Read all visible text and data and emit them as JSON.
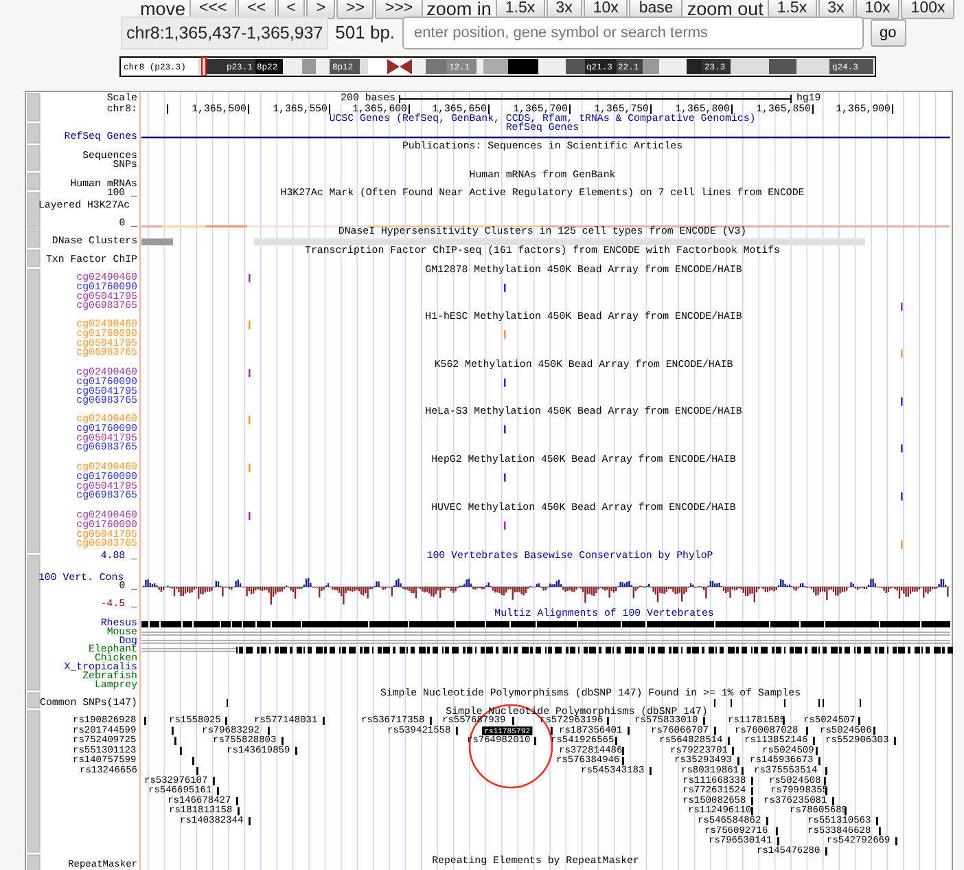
{
  "navigation": {
    "move_label": "move",
    "move_buttons": [
      "<<<",
      "<<",
      "<",
      ">",
      ">>",
      ">>>"
    ],
    "zoom_in_label": "zoom in",
    "zoom_in_buttons": [
      "1.5x",
      "3x",
      "10x",
      "base"
    ],
    "zoom_out_label": "zoom out",
    "zoom_out_buttons": [
      "1.5x",
      "3x",
      "10x",
      "100x"
    ]
  },
  "position": {
    "value": "chr8:1,365,437-1,365,937",
    "size": "501 bp.",
    "search_placeholder": "enter position, gene symbol or search terms",
    "go_button": "go"
  },
  "ideogram": {
    "chromosome_label": "chr8 (p23.3)",
    "bands": [
      "p23.1",
      "8p22",
      "8p12",
      "12.1",
      "q21.3",
      "22.1",
      "23.3",
      "q24.3"
    ]
  },
  "ruler": {
    "scale_label": "Scale",
    "scale_text": "200 bases",
    "assembly": "hg19",
    "chrom_label": "chr8:",
    "positions": [
      "1,365,500",
      "1,365,550",
      "1,365,600",
      "1,365,650",
      "1,365,700",
      "1,365,750",
      "1,365,800",
      "1,365,850",
      "1,365,900"
    ]
  },
  "gene_tracks": {
    "ucsc_genes_title": "UCSC Genes (RefSeq, GenBank, CCDS, Rfam, tRNAs & Comparative Genomics)",
    "refseq_title": "RefSeq Genes",
    "refseq_label": "RefSeq Genes",
    "publications_title": "Publications: Sequences in Scientific Articles",
    "publications_labels": [
      "Sequences",
      "SNPs"
    ],
    "mrna_title": "Human mRNAs from GenBank",
    "mrna_label": "Human mRNAs"
  },
  "h3k27ac": {
    "title": "H3K27Ac Mark (Often Found Near Active Regulatory Elements) on 7 cell lines from ENCODE",
    "label": "Layered H3K27Ac",
    "max": "100 _",
    "min": "0 _"
  },
  "dnase": {
    "title": "DNaseI Hypersensitivity Clusters in 125 cell types from ENCODE (V3)",
    "label": "DNase Clusters"
  },
  "txn_factor": {
    "title": "Transcription Factor ChIP-seq (161 factors) from ENCODE with Factorbook Motifs",
    "label": "Txn Factor ChIP"
  },
  "methylation": [
    {
      "title": "GM12878 Methylation 450K Bead Array from ENCODE/HAIB",
      "probes": [
        {
          "label": "cg02490460",
          "color": "#a03ca0"
        },
        {
          "label": "cg01760090",
          "color": "#3333dd"
        },
        {
          "label": "cg05041795",
          "color": "#a03ca0"
        },
        {
          "label": "cg06983765",
          "color": "#a03ca0"
        }
      ]
    },
    {
      "title": "H1-hESC Methylation 450K Bead Array from ENCODE/HAIB",
      "probes": [
        {
          "label": "cg02490460",
          "color": "#ff9933"
        },
        {
          "label": "cg01760090",
          "color": "#ff9933"
        },
        {
          "label": "cg05041795",
          "color": "#ff9933"
        },
        {
          "label": "cg06983765",
          "color": "#ff9933"
        }
      ]
    },
    {
      "title": "K562 Methylation 450K Bead Array from ENCODE/HAIB",
      "probes": [
        {
          "label": "cg02490460",
          "color": "#a03ca0"
        },
        {
          "label": "cg01760090",
          "color": "#3333dd"
        },
        {
          "label": "cg05041795",
          "color": "#3333dd"
        },
        {
          "label": "cg06983765",
          "color": "#3333dd"
        }
      ]
    },
    {
      "title": "HeLa-S3 Methylation 450K Bead Array from ENCODE/HAIB",
      "probes": [
        {
          "label": "cg02490460",
          "color": "#ff9933"
        },
        {
          "label": "cg01760090",
          "color": "#3333dd"
        },
        {
          "label": "cg05041795",
          "color": "#a03ca0"
        },
        {
          "label": "cg06983765",
          "color": "#3333dd"
        }
      ]
    },
    {
      "title": "HepG2 Methylation 450K Bead Array from ENCODE/HAIB",
      "probes": [
        {
          "label": "cg02490460",
          "color": "#ff9933"
        },
        {
          "label": "cg01760090",
          "color": "#3333dd"
        },
        {
          "label": "cg05041795",
          "color": "#a03ca0"
        },
        {
          "label": "cg06983765",
          "color": "#3333dd"
        }
      ]
    },
    {
      "title": "HUVEC Methylation 450K Bead Array from ENCODE/HAIB",
      "probes": [
        {
          "label": "cg02490460",
          "color": "#a03ca0"
        },
        {
          "label": "cg01760090",
          "color": "#a03ca0"
        },
        {
          "label": "cg05041795",
          "color": "#ff9933"
        },
        {
          "label": "cg06983765",
          "color": "#ff9933"
        }
      ]
    }
  ],
  "conservation": {
    "title": "100 Vertebrates Basewise Conservation by PhyloP",
    "label": "100 Vert. Cons",
    "max": "4.88 _",
    "zero": "0 _",
    "min": "-4.5 _",
    "multiz_title": "Multiz Alignments of 100 Vertebrates",
    "species": [
      {
        "name": "Rhesus",
        "color": "#000099"
      },
      {
        "name": "Mouse",
        "color": "#006600"
      },
      {
        "name": "Dog",
        "color": "#000099"
      },
      {
        "name": "Elephant",
        "color": "#006600"
      },
      {
        "name": "Chicken",
        "color": "#006600"
      },
      {
        "name": "X_tropicalis",
        "color": "#000099"
      },
      {
        "name": "Zebrafish",
        "color": "#006600"
      },
      {
        "name": "Lamprey",
        "color": "#006600"
      }
    ]
  },
  "common_snps": {
    "title": "Simple Nucleotide Polymorphisms (dbSNP 147) Found in >= 1% of Samples",
    "label": "Common SNPs(147)"
  },
  "snps": {
    "title": "Simple Nucleotide Polymorphisms (dbSNP 147)",
    "rows": [
      {
        "snps": [
          {
            "label": "rs190826928",
            "selected": false
          },
          {
            "label": "rs1558025",
            "selected": false
          },
          {
            "label": "rs577148031",
            "selected": false
          },
          {
            "label": "rs536717358",
            "selected": false
          },
          {
            "label": "rs557687939",
            "selected": false
          },
          {
            "label": "rs572963196",
            "selected": false
          },
          {
            "label": "rs575833010",
            "selected": false
          },
          {
            "label": "rs11781585",
            "selected": false
          },
          {
            "label": "rs5024507",
            "selected": false
          }
        ]
      },
      {
        "snps": [
          {
            "label": "rs201744599",
            "selected": false
          },
          {
            "label": "rs79683292",
            "selected": false
          },
          {
            "label": "rs539421558",
            "selected": false
          },
          {
            "label": "rs11785792",
            "selected": true
          },
          {
            "label": "rs187356401",
            "selected": false
          },
          {
            "label": "rs76066707",
            "selected": false
          },
          {
            "label": "rs760087028",
            "selected": false
          },
          {
            "label": "rs5024506",
            "selected": false
          }
        ]
      },
      {
        "snps": [
          {
            "label": "rs752409725",
            "selected": false
          },
          {
            "label": "rs755828803",
            "selected": false
          },
          {
            "label": "rs764982010",
            "selected": false
          },
          {
            "label": "rs541926565",
            "selected": false
          },
          {
            "label": "rs564828514",
            "selected": false
          },
          {
            "label": "rs113852146",
            "selected": false
          },
          {
            "label": "rs552906303",
            "selected": false
          }
        ]
      },
      {
        "snps": [
          {
            "label": "rs551301123",
            "selected": false
          },
          {
            "label": "rs143619859",
            "selected": false
          },
          {
            "label": "rs372814486",
            "selected": false
          },
          {
            "label": "rs79223701",
            "selected": false
          },
          {
            "label": "rs5024509",
            "selected": false
          }
        ]
      },
      {
        "snps": [
          {
            "label": "rs140757599",
            "selected": false
          },
          {
            "label": "rs576384946",
            "selected": false
          },
          {
            "label": "rs35293493",
            "selected": false
          },
          {
            "label": "rs145936673",
            "selected": false
          }
        ]
      },
      {
        "snps": [
          {
            "label": "rs13246656",
            "selected": false
          },
          {
            "label": "rs545343183",
            "selected": false
          },
          {
            "label": "rs80319861",
            "selected": false
          },
          {
            "label": "rs375553514",
            "selected": false
          }
        ]
      },
      {
        "snps": [
          {
            "label": "rs532976107",
            "selected": false
          },
          {
            "label": "rs111668338",
            "selected": false
          },
          {
            "label": "rs5024508",
            "selected": false
          }
        ]
      },
      {
        "snps": [
          {
            "label": "rs546695161",
            "selected": false
          },
          {
            "label": "rs772631524",
            "selected": false
          },
          {
            "label": "rs79998355",
            "selected": false
          }
        ]
      },
      {
        "snps": [
          {
            "label": "rs146678427",
            "selected": false
          },
          {
            "label": "rs150082658",
            "selected": false
          },
          {
            "label": "rs376235081",
            "selected": false
          }
        ]
      },
      {
        "snps": [
          {
            "label": "rs181813158",
            "selected": false
          },
          {
            "label": "rs112496110",
            "selected": false
          },
          {
            "label": "rs78605689",
            "selected": false
          }
        ]
      },
      {
        "snps": [
          {
            "label": "rs140382344",
            "selected": false
          },
          {
            "label": "rs546584862",
            "selected": false
          },
          {
            "label": "rs551310563",
            "selected": false
          }
        ]
      },
      {
        "snps": [
          {
            "label": "rs756092716",
            "selected": false
          },
          {
            "label": "rs533846628",
            "selected": false
          }
        ]
      },
      {
        "snps": [
          {
            "label": "rs796530141",
            "selected": false
          },
          {
            "label": "rs542792669",
            "selected": false
          }
        ]
      },
      {
        "snps": [
          {
            "label": "rs145476280",
            "selected": false
          }
        ]
      }
    ]
  },
  "repeatmasker": {
    "title": "Repeating Elements by RepeatMasker",
    "label": "RepeatMasker"
  }
}
